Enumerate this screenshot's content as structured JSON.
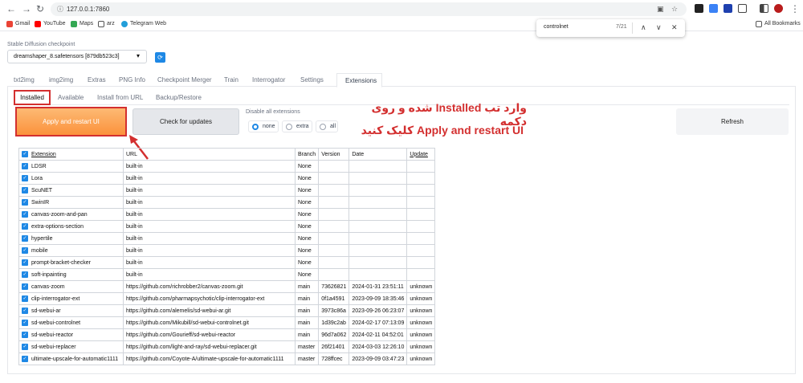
{
  "browser": {
    "url": "127.0.0.1:7860",
    "bookmarks": [
      "Gmail",
      "YouTube",
      "Maps",
      "arz",
      "Telegram Web"
    ],
    "all_bookmarks": "All Bookmarks"
  },
  "find_bar": {
    "query": "controlnet",
    "count": "7/21"
  },
  "checkpoint": {
    "label": "Stable Diffusion checkpoint",
    "value": "dreamshaper_8.safetensors [879db523c3]"
  },
  "main_tabs": [
    "txt2img",
    "img2img",
    "Extras",
    "PNG Info",
    "Checkpoint Merger",
    "Train",
    "Interrogator",
    "Settings",
    "Extensions"
  ],
  "sub_tabs": [
    "Installed",
    "Available",
    "Install from URL",
    "Backup/Restore"
  ],
  "buttons": {
    "apply": "Apply and restart UI",
    "check": "Check for updates",
    "refresh": "Refresh"
  },
  "disable": {
    "label": "Disable all extensions",
    "options": [
      "none",
      "extra",
      "all"
    ],
    "selected": "none"
  },
  "annotation": {
    "line1": "وارد تب Installed شده و روی دکمه",
    "line2": "Apply and restart UI کلیک کنید"
  },
  "table": {
    "headers": [
      "Extension",
      "URL",
      "Branch",
      "Version",
      "Date",
      "Update"
    ],
    "rows": [
      {
        "name": "LDSR",
        "url": "built-in",
        "branch": "None",
        "version": "",
        "date": "",
        "update": ""
      },
      {
        "name": "Lora",
        "url": "built-in",
        "branch": "None",
        "version": "",
        "date": "",
        "update": ""
      },
      {
        "name": "ScuNET",
        "url": "built-in",
        "branch": "None",
        "version": "",
        "date": "",
        "update": ""
      },
      {
        "name": "SwinIR",
        "url": "built-in",
        "branch": "None",
        "version": "",
        "date": "",
        "update": ""
      },
      {
        "name": "canvas-zoom-and-pan",
        "url": "built-in",
        "branch": "None",
        "version": "",
        "date": "",
        "update": ""
      },
      {
        "name": "extra-options-section",
        "url": "built-in",
        "branch": "None",
        "version": "",
        "date": "",
        "update": ""
      },
      {
        "name": "hypertile",
        "url": "built-in",
        "branch": "None",
        "version": "",
        "date": "",
        "update": ""
      },
      {
        "name": "mobile",
        "url": "built-in",
        "branch": "None",
        "version": "",
        "date": "",
        "update": ""
      },
      {
        "name": "prompt-bracket-checker",
        "url": "built-in",
        "branch": "None",
        "version": "",
        "date": "",
        "update": ""
      },
      {
        "name": "soft-inpainting",
        "url": "built-in",
        "branch": "None",
        "version": "",
        "date": "",
        "update": ""
      },
      {
        "name": "canvas-zoom",
        "url": "https://github.com/richrobber2/canvas-zoom.git",
        "branch": "main",
        "version": "73626821",
        "date": "2024-01-31 23:51:11",
        "update": "unknown"
      },
      {
        "name": "clip-interrogator-ext",
        "url": "https://github.com/pharmapsychotic/clip-interrogator-ext",
        "branch": "main",
        "version": "0f1a4591",
        "date": "2023-09-09 18:35:46",
        "update": "unknown"
      },
      {
        "name": "sd-webui-ar",
        "url": "https://github.com/alemelis/sd-webui-ar.git",
        "branch": "main",
        "version": "3973c86a",
        "date": "2023-09-26 06:23:07",
        "update": "unknown"
      },
      {
        "name": "sd-webui-controlnet",
        "url": "https://github.com/Mikubill/sd-webui-controlnet.git",
        "branch": "main",
        "version": "1d39c2ab",
        "date": "2024-02-17 07:13:09",
        "update": "unknown"
      },
      {
        "name": "sd-webui-reactor",
        "url": "https://github.com/Gourieff/sd-webui-reactor",
        "branch": "main",
        "version": "96d7a062",
        "date": "2024-02-11 04:52:01",
        "update": "unknown"
      },
      {
        "name": "sd-webui-replacer",
        "url": "https://github.com/light-and-ray/sd-webui-replacer.git",
        "branch": "master",
        "version": "26f21401",
        "date": "2024-03-03 12:26:10",
        "update": "unknown"
      },
      {
        "name": "ultimate-upscale-for-automatic1111",
        "url": "https://github.com/Coyote-A/ultimate-upscale-for-automatic1111",
        "branch": "master",
        "version": "728ffcec",
        "date": "2023-09-09 03:47:23",
        "update": "unknown"
      }
    ]
  },
  "colors": {
    "accent": "#1e88e5",
    "annotation": "#d32f2f",
    "apply": "#fb923c"
  }
}
